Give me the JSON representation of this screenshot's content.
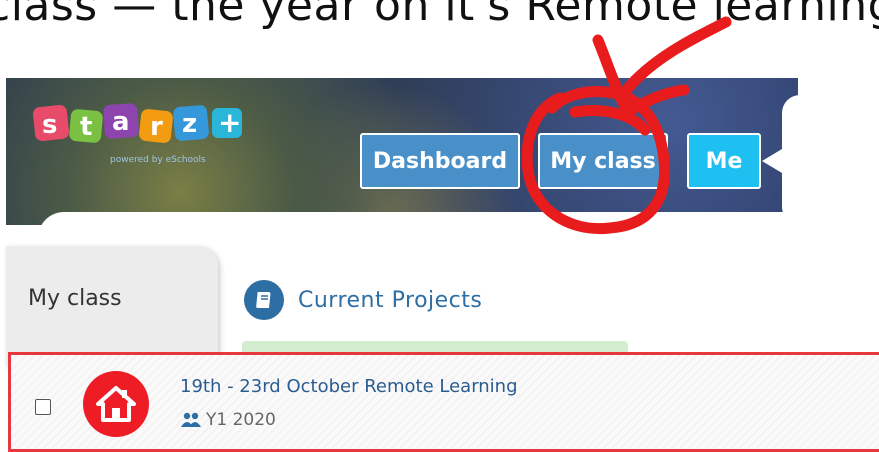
{
  "caption": {
    "text": "class — the year on it's Remote learning activ..."
  },
  "header": {
    "logo_text": [
      "s",
      "t",
      "a",
      "r",
      "z",
      "+"
    ],
    "logo_sub": "powered by eSchools",
    "nav": {
      "dashboard": "Dashboard",
      "my_class": "My class",
      "me": "Me"
    }
  },
  "tabs": {
    "my_class": "My class",
    "current_projects": "Current Projects"
  },
  "project": {
    "title": "19th - 23rd October Remote Learning",
    "group": "Y1 2020"
  },
  "colors": {
    "nav_blue": "#4a90c8",
    "me_cyan": "#1ec0f2",
    "accent_red": "#e8383f",
    "project_blue": "#2d6ea5"
  },
  "icons": {
    "book": "book-icon",
    "home": "home-icon",
    "people": "people-icon"
  }
}
